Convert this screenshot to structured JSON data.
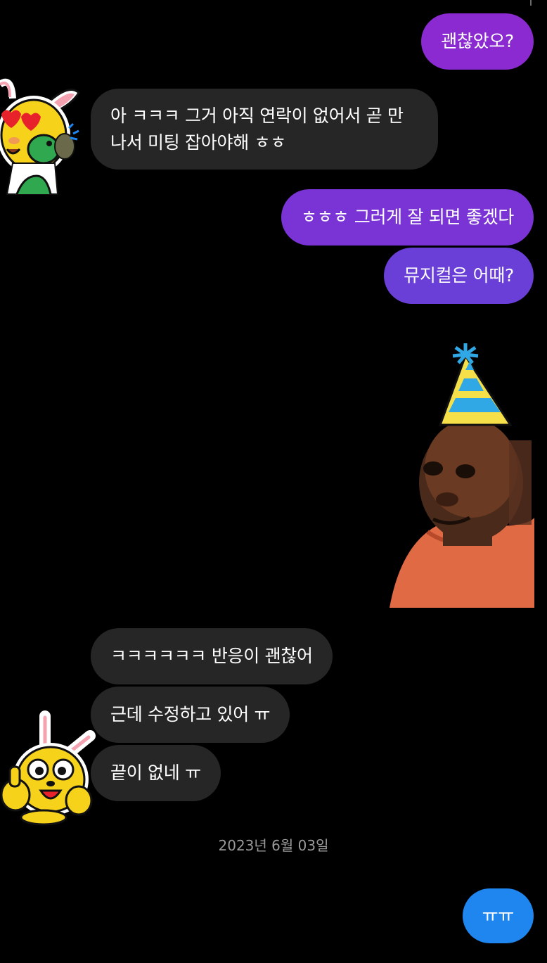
{
  "colors": {
    "background": "#000000",
    "incoming_bubble": "#262626",
    "outgoing_purple_1": "#8a2ad0",
    "outgoing_purple_2": "#7a34d6",
    "outgoing_purple_3": "#6a3fd8",
    "outgoing_blue": "#1f86f0",
    "muted_text": "#9a9a9a"
  },
  "messages": [
    {
      "direction": "out",
      "text": "괜찮았오?"
    },
    {
      "direction": "in",
      "text": "아 ㅋㅋㅋ 그거 아직 연락이 없어서 곧 만나서 미팅 잡아야해 ㅎㅎ"
    },
    {
      "direction": "out",
      "text": "ㅎㅎㅎ 그러게 잘 되면 좋겠다"
    },
    {
      "direction": "out",
      "text": "뮤지컬은 어때?"
    },
    {
      "direction": "out",
      "sticker": "party-hat-man-sticker"
    },
    {
      "direction": "in",
      "text": "ㅋㅋㅋㅋㅋㅋ 반응이 괜찮어"
    },
    {
      "direction": "in",
      "text": "근데 수정하고 있어 ㅠ"
    },
    {
      "direction": "in",
      "text": "끝이 없네 ㅠ"
    },
    {
      "direction": "out",
      "text": "ㅠㅠ"
    }
  ],
  "date_separator": "2023년 6월 03일",
  "icons": {
    "sticker_1": "rabbit-hearts-sticker",
    "sticker_2": "party-hat-man-sticker",
    "sticker_3": "rabbit-thumbs-up-sticker"
  }
}
